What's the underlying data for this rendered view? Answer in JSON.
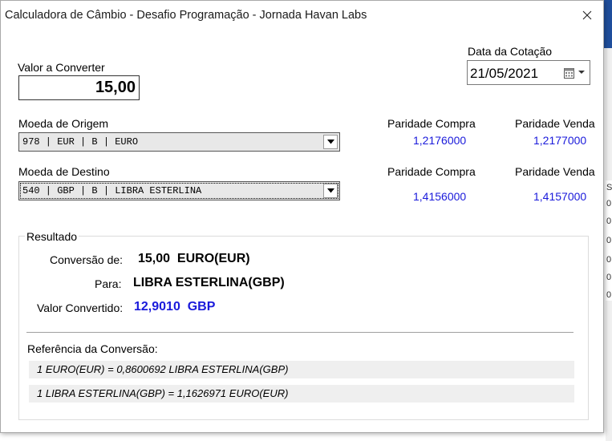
{
  "window": {
    "title": "Calculadora de Câmbio - Desafio Programação - Jornada Havan Labs"
  },
  "valor": {
    "label": "Valor a Converter",
    "value": "15,00"
  },
  "data_cotacao": {
    "label": "Data da Cotação",
    "value": "21/05/2021"
  },
  "origem": {
    "label": "Moeda de Origem",
    "selected": "978 | EUR | B | EURO",
    "paridade_compra_label": "Paridade Compra",
    "paridade_venda_label": "Paridade Venda",
    "paridade_compra": "1,2176000",
    "paridade_venda": "1,2177000"
  },
  "destino": {
    "label": "Moeda de Destino",
    "selected": "540 | GBP | B | LIBRA ESTERLINA",
    "paridade_compra_label": "Paridade Compra",
    "paridade_venda_label": "Paridade Venda",
    "paridade_compra": "1,4156000",
    "paridade_venda": "1,4157000"
  },
  "resultado": {
    "legend": "Resultado",
    "conversao_label": "Conversão de:",
    "conversao_value": "15,00  EURO(EUR)",
    "para_label": "Para:",
    "para_value": "LIBRA ESTERLINA(GBP)",
    "valor_convertido_label": "Valor Convertido:",
    "valor_convertido_value": "12,9010  GBP",
    "referencia_label": "Referência da Conversão:",
    "referencias": [
      "1 EURO(EUR) = 0,8600692 LIBRA ESTERLINA(GBP)",
      "1 LIBRA ESTERLINA(GBP) = 1,1626971 EURO(EUR)"
    ]
  },
  "background": {
    "marks": [
      "S",
      "0",
      "0",
      "0",
      "0",
      "0",
      "0"
    ]
  },
  "colors": {
    "accent_blue": "#1a1adb"
  }
}
